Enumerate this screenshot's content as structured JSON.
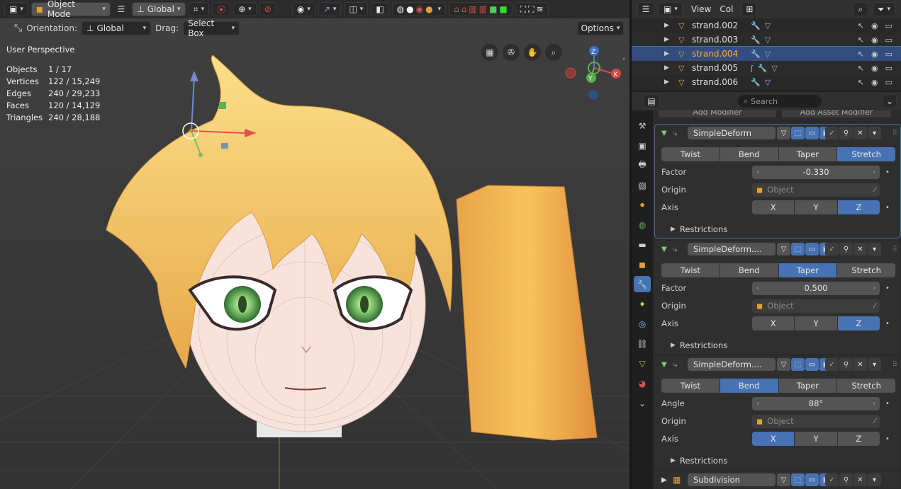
{
  "header": {
    "mode": "Object Mode",
    "transform_space": "Global"
  },
  "subheader": {
    "orientation_label": "Orientation:",
    "orientation_value": "Global",
    "drag_label": "Drag:",
    "drag_value": "Select Box",
    "options": "Options"
  },
  "overlay": {
    "perspective": "User Perspective",
    "stats": [
      {
        "k": "Objects",
        "v": "1 / 17"
      },
      {
        "k": "Vertices",
        "v": "122 / 15,249"
      },
      {
        "k": "Edges",
        "v": "240 / 29,233"
      },
      {
        "k": "Faces",
        "v": "120 / 14,129"
      },
      {
        "k": "Triangles",
        "v": "240 / 28,188"
      }
    ]
  },
  "gizmo": {
    "x": "X",
    "y": "Y",
    "z": "Z"
  },
  "outliner": {
    "menu_view": "View",
    "menu_col": "Col",
    "rows": [
      {
        "name": "strand.002",
        "selected": false
      },
      {
        "name": "strand.003",
        "selected": false
      },
      {
        "name": "strand.004",
        "selected": true
      },
      {
        "name": "strand.005",
        "selected": false
      },
      {
        "name": "strand.006",
        "selected": false
      }
    ]
  },
  "properties": {
    "search_placeholder": "Search",
    "add_modifier": "Add Modifier",
    "add_asset_modifier": "Add Asset Modifier",
    "modifiers": [
      {
        "name": "SimpleDeform",
        "modes": [
          "Twist",
          "Bend",
          "Taper",
          "Stretch"
        ],
        "active_mode": "Stretch",
        "param_label": "Factor",
        "param_value": "-0.330",
        "origin_label": "Origin",
        "origin_placeholder": "Object",
        "axis_label": "Axis",
        "axes": [
          "X",
          "Y",
          "Z"
        ],
        "active_axis": "Z",
        "restrictions": "Restrictions"
      },
      {
        "name": "SimpleDeform....",
        "modes": [
          "Twist",
          "Bend",
          "Taper",
          "Stretch"
        ],
        "active_mode": "Taper",
        "param_label": "Factor",
        "param_value": "0.500",
        "origin_label": "Origin",
        "origin_placeholder": "Object",
        "axis_label": "Axis",
        "axes": [
          "X",
          "Y",
          "Z"
        ],
        "active_axis": "Z",
        "restrictions": "Restrictions"
      },
      {
        "name": "SimpleDeform....",
        "modes": [
          "Twist",
          "Bend",
          "Taper",
          "Stretch"
        ],
        "active_mode": "Bend",
        "param_label": "Angle",
        "param_value": "88°",
        "origin_label": "Origin",
        "origin_placeholder": "Object",
        "axis_label": "Axis",
        "axes": [
          "X",
          "Y",
          "Z"
        ],
        "active_axis": "X",
        "restrictions": "Restrictions"
      }
    ],
    "collapsed_modifier": "Subdivision"
  },
  "colors": {
    "accent": "#4772b3",
    "selected_text": "#ffaf29",
    "hair": "#f2c25a"
  }
}
